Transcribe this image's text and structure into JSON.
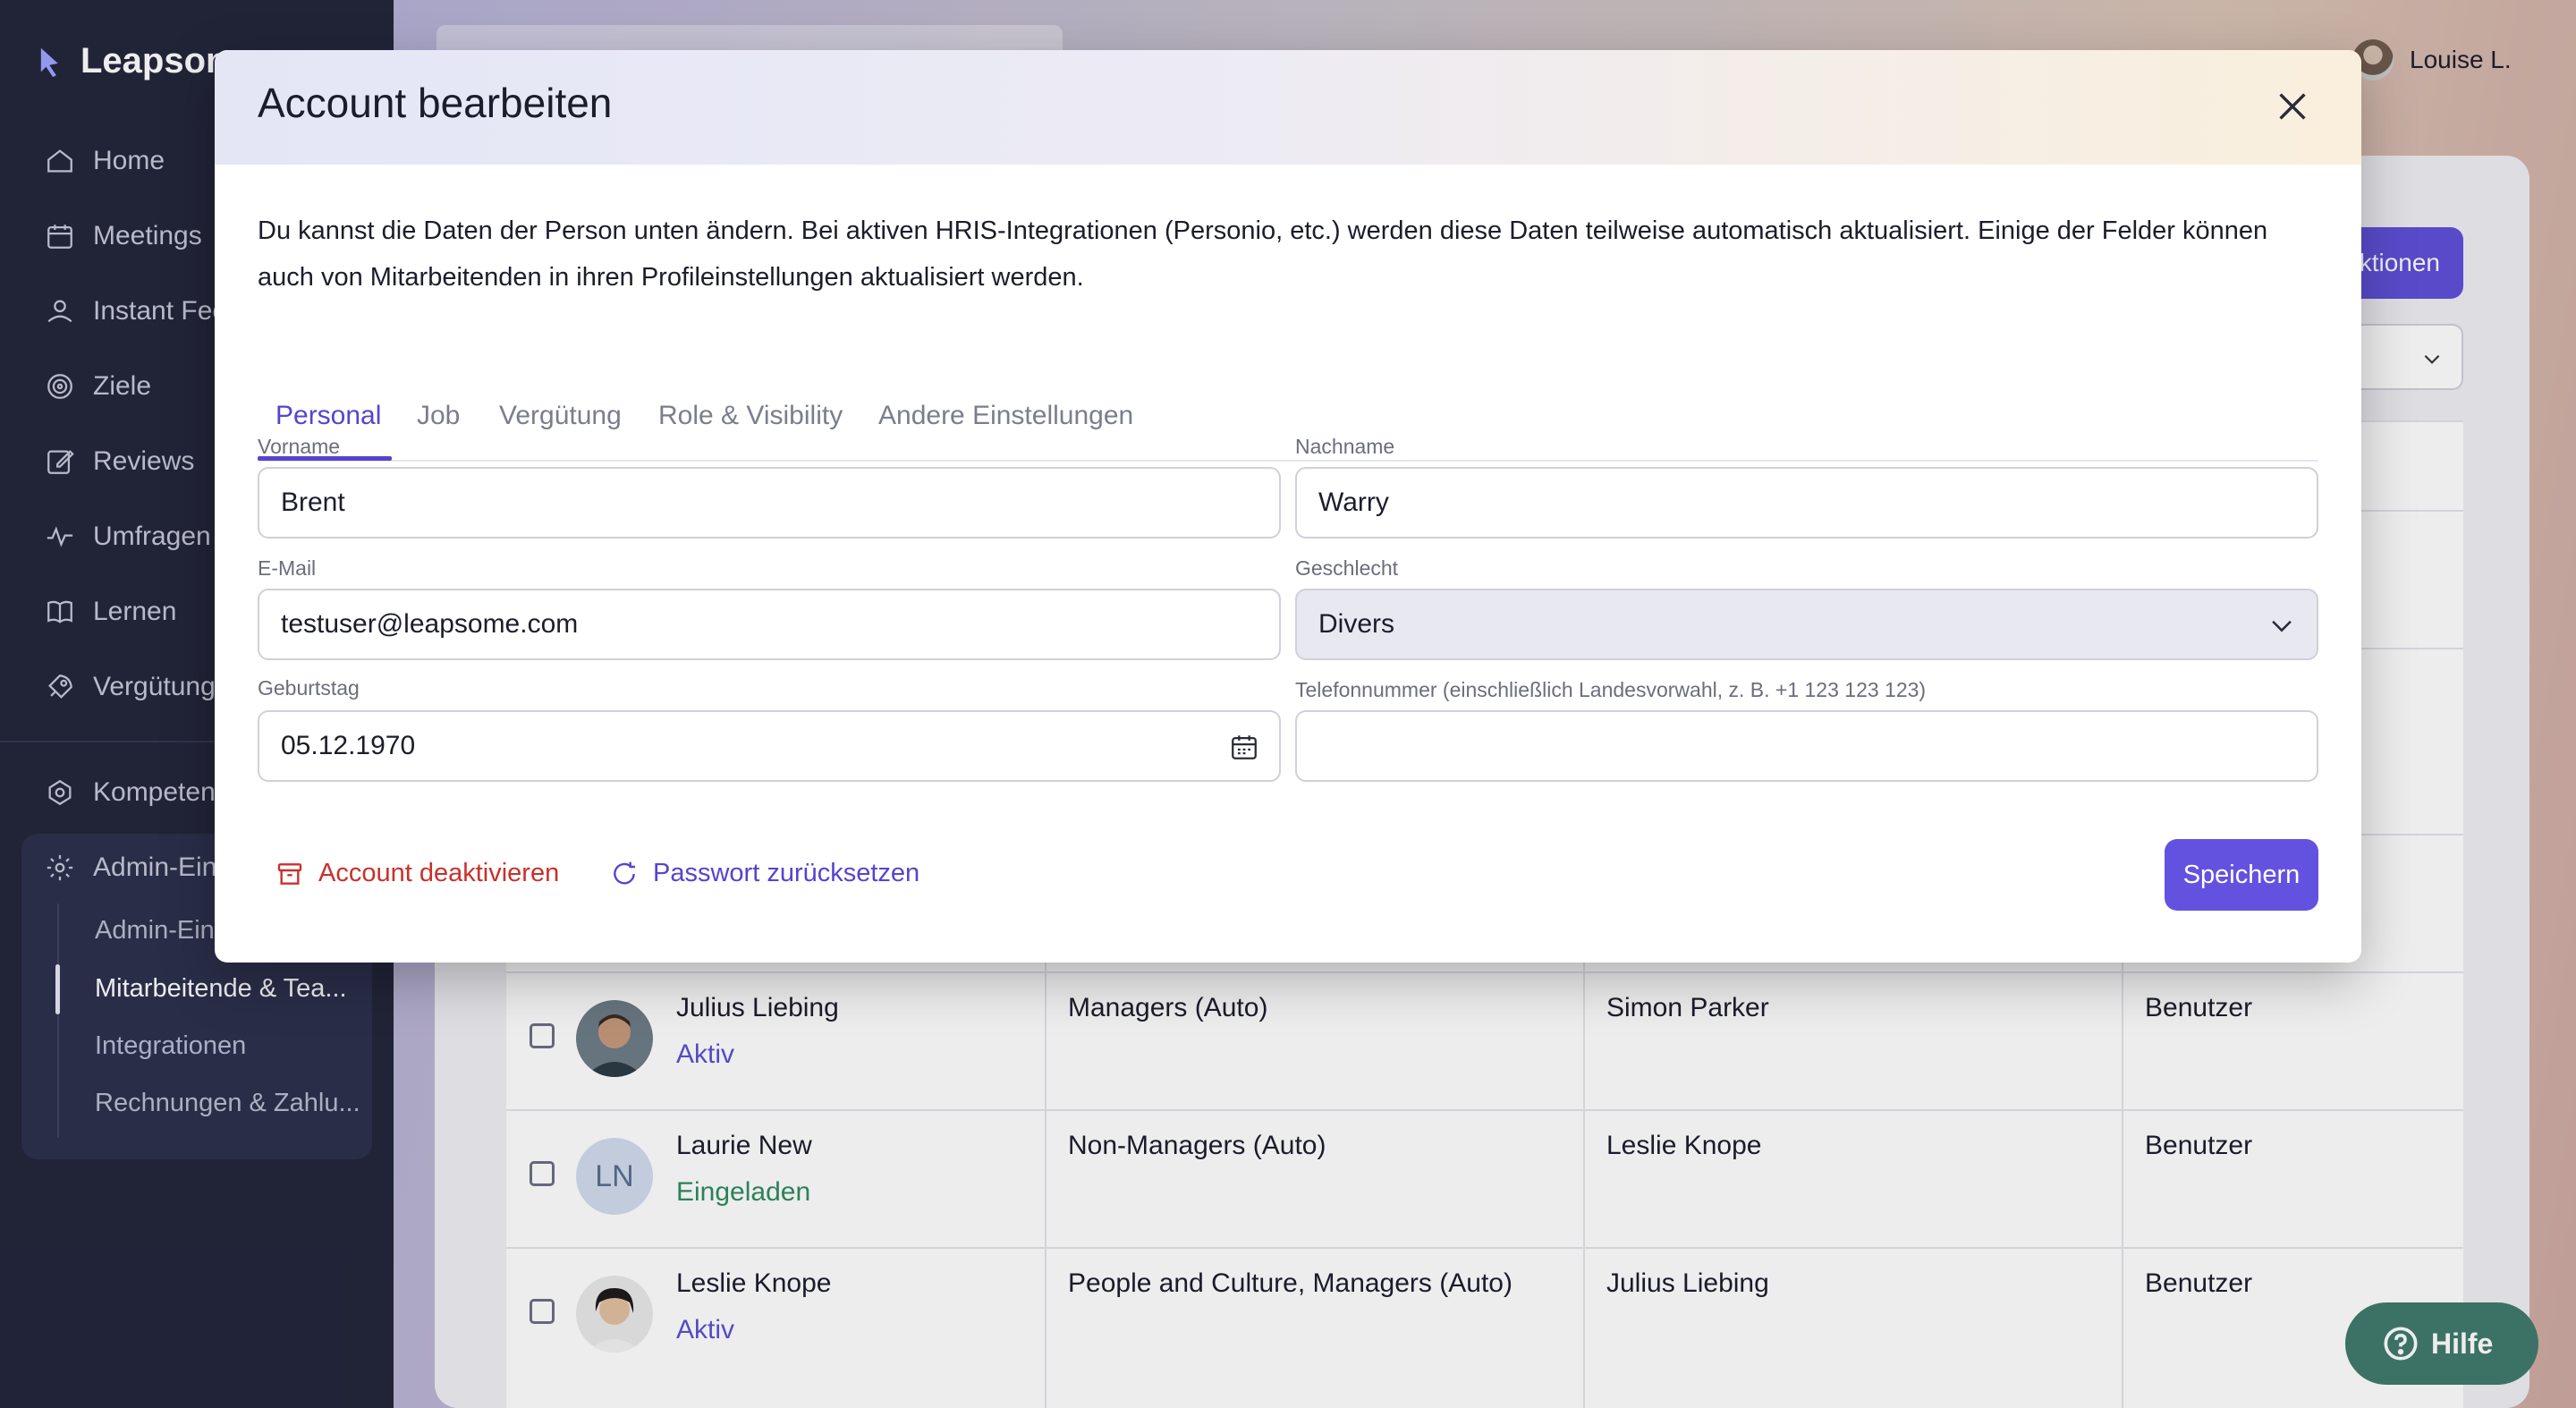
{
  "app": {
    "logo_text": "Leapsome"
  },
  "sidebar": {
    "items": [
      {
        "label": "Home",
        "icon": "home-icon"
      },
      {
        "label": "Meetings",
        "icon": "calendar-icon"
      },
      {
        "label": "Instant Feedback",
        "icon": "feedback-icon"
      },
      {
        "label": "Ziele",
        "icon": "target-icon"
      },
      {
        "label": "Reviews",
        "icon": "edit-icon"
      },
      {
        "label": "Umfragen",
        "icon": "pulse-icon"
      },
      {
        "label": "Lernen",
        "icon": "book-icon"
      },
      {
        "label": "Vergütung",
        "icon": "rocket-icon"
      },
      {
        "label": "Kompetenzen",
        "icon": "network-icon"
      },
      {
        "label": "Admin-Einstellungen",
        "icon": "gear-icon"
      }
    ],
    "admin_sub": [
      {
        "label": "Admin-Einstellungen"
      },
      {
        "label": "Mitarbeitende & Tea...",
        "active": true
      },
      {
        "label": "Integrationen"
      },
      {
        "label": "Rechnungen & Zahlu..."
      }
    ]
  },
  "header": {
    "user_name": "Louise L."
  },
  "main": {
    "actions_label": "Aktionen",
    "rows": [
      {
        "name": "Julius Liebing",
        "status": "Aktiv",
        "teams": "Managers (Auto)",
        "manager": "Simon Parker",
        "role": "Benutzer"
      },
      {
        "name": "Laurie New",
        "initials": "LN",
        "status": "Eingeladen",
        "teams": "Non-Managers (Auto)",
        "manager": "Leslie Knope",
        "role": "Benutzer"
      },
      {
        "name": "Leslie Knope",
        "status": "Aktiv",
        "teams": "People and Culture, Managers (Auto)",
        "manager": "Julius Liebing",
        "role": "Benutzer"
      }
    ]
  },
  "help": {
    "label": "Hilfe"
  },
  "modal": {
    "title": "Account bearbeiten",
    "description": "Du kannst die Daten der Person unten ändern. Bei aktiven HRIS-Integrationen (Personio, etc.) werden diese Daten teilweise automatisch aktualisiert. Einige der Felder können auch von Mitarbeitenden in ihren Profileinstellungen aktualisiert werden.",
    "tabs": [
      "Personal",
      "Job",
      "Vergütung",
      "Role & Visibility",
      "Andere Einstellungen"
    ],
    "fields": {
      "first_name": {
        "label": "Vorname",
        "value": "Brent"
      },
      "last_name": {
        "label": "Nachname",
        "value": "Warry"
      },
      "email": {
        "label": "E-Mail",
        "value": "testuser@leapsome.com"
      },
      "gender": {
        "label": "Geschlecht",
        "value": "Divers"
      },
      "birthday": {
        "label": "Geburtstag",
        "value": "05.12.1970"
      },
      "phone": {
        "label": "Telefonnummer (einschließlich Landesvorwahl, z. B. +1 123 123 123)",
        "value": ""
      }
    },
    "deactivate_label": "Account deaktivieren",
    "reset_label": "Passwort zurücksetzen",
    "save_label": "Speichern"
  },
  "colors": {
    "accent": "#5544d0",
    "danger": "#c9302c",
    "sidebar": "#222439",
    "help": "#3f7a6b"
  }
}
